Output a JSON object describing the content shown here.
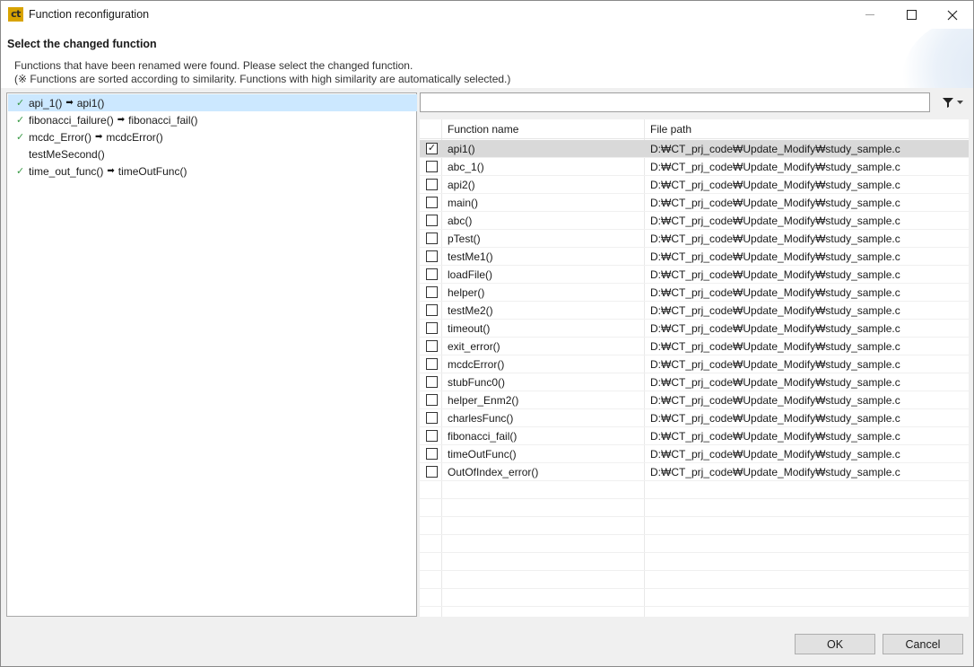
{
  "window": {
    "title": "Function reconfiguration"
  },
  "header": {
    "title": "Select the changed function",
    "line1": "Functions that have been renamed were found. Please select the changed function.",
    "line2": "(※ Functions are sorted according to similarity. Functions with high similarity are automatically selected.)"
  },
  "tree": {
    "items": [
      {
        "from": "api_1()",
        "to": "api1()",
        "checked": true,
        "selected": true
      },
      {
        "from": "fibonacci_failure()",
        "to": "fibonacci_fail()",
        "checked": true,
        "selected": false
      },
      {
        "from": "mcdc_Error()",
        "to": "mcdcError()",
        "checked": true,
        "selected": false
      },
      {
        "from": "testMeSecond()",
        "to": "",
        "checked": false,
        "selected": false
      },
      {
        "from": "time_out_func()",
        "to": "timeOutFunc()",
        "checked": true,
        "selected": false
      }
    ]
  },
  "search": {
    "value": "",
    "placeholder": ""
  },
  "table": {
    "headers": {
      "name": "Function name",
      "path": "File path"
    },
    "rows": [
      {
        "name": "api1()",
        "path": "D:₩CT_prj_code₩Update_Modify₩study_sample.c",
        "checked": true,
        "selected": true
      },
      {
        "name": "abc_1()",
        "path": "D:₩CT_prj_code₩Update_Modify₩study_sample.c",
        "checked": false,
        "selected": false
      },
      {
        "name": "api2()",
        "path": "D:₩CT_prj_code₩Update_Modify₩study_sample.c",
        "checked": false,
        "selected": false
      },
      {
        "name": "main()",
        "path": "D:₩CT_prj_code₩Update_Modify₩study_sample.c",
        "checked": false,
        "selected": false
      },
      {
        "name": "abc()",
        "path": "D:₩CT_prj_code₩Update_Modify₩study_sample.c",
        "checked": false,
        "selected": false
      },
      {
        "name": "pTest()",
        "path": "D:₩CT_prj_code₩Update_Modify₩study_sample.c",
        "checked": false,
        "selected": false
      },
      {
        "name": "testMe1()",
        "path": "D:₩CT_prj_code₩Update_Modify₩study_sample.c",
        "checked": false,
        "selected": false
      },
      {
        "name": "loadFile()",
        "path": "D:₩CT_prj_code₩Update_Modify₩study_sample.c",
        "checked": false,
        "selected": false
      },
      {
        "name": "helper()",
        "path": "D:₩CT_prj_code₩Update_Modify₩study_sample.c",
        "checked": false,
        "selected": false
      },
      {
        "name": "testMe2()",
        "path": "D:₩CT_prj_code₩Update_Modify₩study_sample.c",
        "checked": false,
        "selected": false
      },
      {
        "name": "timeout()",
        "path": "D:₩CT_prj_code₩Update_Modify₩study_sample.c",
        "checked": false,
        "selected": false
      },
      {
        "name": "exit_error()",
        "path": "D:₩CT_prj_code₩Update_Modify₩study_sample.c",
        "checked": false,
        "selected": false
      },
      {
        "name": "mcdcError()",
        "path": "D:₩CT_prj_code₩Update_Modify₩study_sample.c",
        "checked": false,
        "selected": false
      },
      {
        "name": "stubFunc0()",
        "path": "D:₩CT_prj_code₩Update_Modify₩study_sample.c",
        "checked": false,
        "selected": false
      },
      {
        "name": "helper_Enm2()",
        "path": "D:₩CT_prj_code₩Update_Modify₩study_sample.c",
        "checked": false,
        "selected": false
      },
      {
        "name": "charlesFunc()",
        "path": "D:₩CT_prj_code₩Update_Modify₩study_sample.c",
        "checked": false,
        "selected": false
      },
      {
        "name": "fibonacci_fail()",
        "path": "D:₩CT_prj_code₩Update_Modify₩study_sample.c",
        "checked": false,
        "selected": false
      },
      {
        "name": "timeOutFunc()",
        "path": "D:₩CT_prj_code₩Update_Modify₩study_sample.c",
        "checked": false,
        "selected": false
      },
      {
        "name": "OutOfIndex_error()",
        "path": "D:₩CT_prj_code₩Update_Modify₩study_sample.c",
        "checked": false,
        "selected": false
      }
    ]
  },
  "buttons": {
    "ok": "OK",
    "cancel": "Cancel"
  },
  "colors": {
    "selection": "#cce8ff",
    "row_selected": "#d9d9d9",
    "check": "#3a9a46"
  },
  "icons": {
    "app": "ct-app-icon",
    "minimize": "minimize-icon",
    "maximize": "maximize-icon",
    "close": "close-icon",
    "filter": "filter-icon",
    "dropdown": "chevron-down-icon",
    "check": "checkmark-icon",
    "arrow": "right-arrow-icon"
  }
}
